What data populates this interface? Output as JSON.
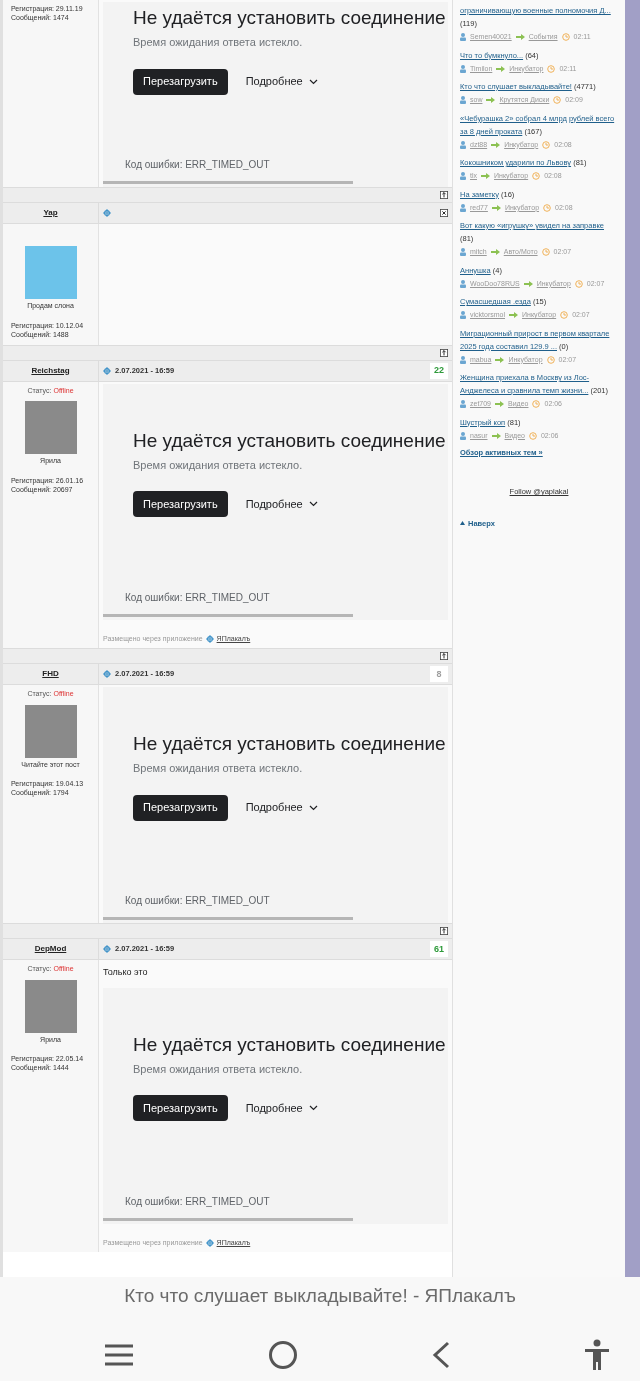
{
  "posts": [
    {
      "registration": "Регистрация: 29.11.19",
      "messages": "Сообщений: 1474",
      "embed": {
        "heading": "Не удаётся установить соединение",
        "subtitle": "Время ожидания ответа истекло.",
        "reload": "Перезагрузить",
        "details": "Подробнее",
        "error_code": "Код ошибки: ERR_TIMED_OUT"
      }
    },
    {
      "username": "Yap",
      "caption": "Продам слона",
      "registration": "Регистрация: 10.12.04",
      "messages": "Сообщений: 1488"
    },
    {
      "username": "Reichstag",
      "date": "2.07.2021 - 16:59",
      "rating": {
        "text": "22",
        "color": "#2e9a3a"
      },
      "status_label": "Статус:",
      "status": "Offline",
      "caption": "Ярила",
      "registration": "Регистрация: 26.01.16",
      "messages": "Сообщений: 20697",
      "embed": {
        "heading": "Не удаётся установить соединение",
        "subtitle": "Время ожидания ответа истекло.",
        "reload": "Перезагрузить",
        "details": "Подробнее",
        "error_code": "Код ошибки: ERR_TIMED_OUT"
      },
      "via": {
        "label": "Размещено через приложение",
        "app": "ЯПлакалъ"
      }
    },
    {
      "username": "FHD",
      "date": "2.07.2021 - 16:59",
      "rating": {
        "text": "8",
        "color": "#9e9e9e"
      },
      "status_label": "Статус:",
      "status": "Offline",
      "caption": "Читайте этот пост",
      "registration": "Регистрация: 19.04.13",
      "messages": "Сообщений: 1794",
      "embed": {
        "heading": "Не удаётся установить соединение",
        "subtitle": "Время ожидания ответа истекло.",
        "reload": "Перезагрузить",
        "details": "Подробнее",
        "error_code": "Код ошибки: ERR_TIMED_OUT"
      }
    },
    {
      "username": "DepMod",
      "date": "2.07.2021 - 16:59",
      "rating": {
        "text": "61",
        "color": "#2e9a3a"
      },
      "status_label": "Статус:",
      "status": "Offline",
      "caption": "Ярила",
      "registration": "Регистрация: 22.05.14",
      "messages": "Сообщений: 1444",
      "text": "Только это",
      "embed": {
        "heading": "Не удаётся установить соединение",
        "subtitle": "Время ожидания ответа истекло.",
        "reload": "Перезагрузить",
        "details": "Подробнее",
        "error_code": "Код ошибки: ERR_TIMED_OUT"
      },
      "via": {
        "label": "Размещено через приложение",
        "app": "ЯПлакалъ"
      }
    }
  ],
  "sidebar": {
    "topics": [
      {
        "title": "ограничивающую военные полномочия Д...",
        "count": "(119)",
        "author": "Semen40021",
        "section": "События",
        "time": "02:11"
      },
      {
        "title": "Что то бумкнуло...",
        "count": "(64)",
        "author": "Timilon",
        "section": "Инкубатор",
        "time": "02:11"
      },
      {
        "title": "Кто что слушает выкладывайте!",
        "count": "(4771)",
        "author": "sow",
        "section": "Крутятся Диски",
        "time": "02:09"
      },
      {
        "title": "«Чебурашка 2» собрал 4 млрд рублей всего за 8 дней проката",
        "count": "(167)",
        "author": "dzt88",
        "section": "Инкубатор",
        "time": "02:08"
      },
      {
        "title": "Кокошником ударили по Львову",
        "count": "(81)",
        "author": "tlx",
        "section": "Инкубатор",
        "time": "02:08"
      },
      {
        "title": "На заметку",
        "count": "(16)",
        "author": "red77",
        "section": "Инкубатор",
        "time": "02:08"
      },
      {
        "title": "Вот какую «игрушку» увидел на заправке",
        "count": "(81)",
        "author": "mitch",
        "section": "Авто/Мото",
        "time": "02:07"
      },
      {
        "title": "Аннушка",
        "count": "(4)",
        "author": "WooDoo78RUS",
        "section": "Инкубатор",
        "time": "02:07"
      },
      {
        "title": "Сумасшедшая .езда",
        "count": "(15)",
        "author": "vicktorsmol",
        "section": "Инкубатор",
        "time": "02:07"
      },
      {
        "title": "Миграционный прирост в первом квартале 2025 года составил 129.9 ...",
        "count": "(0)",
        "author": "mabua",
        "section": "Инкубатор",
        "time": "02:07"
      },
      {
        "title": "Женщина приехала в Москву из Лос-Анджелеса и сравнила темп жизни...",
        "count": "(201)",
        "author": "zet709",
        "section": "Видео",
        "time": "02:06"
      },
      {
        "title": "Шустрый коп",
        "count": "(81)",
        "author": "nasur",
        "section": "Видео",
        "time": "02:06"
      }
    ],
    "overview_link": "Обзор активных тем »",
    "follow": "Follow @yaplakal",
    "to_top": "Наверх"
  },
  "browser": {
    "page_title": "Кто что слушает выкладывайте! - ЯПлакалъ"
  }
}
